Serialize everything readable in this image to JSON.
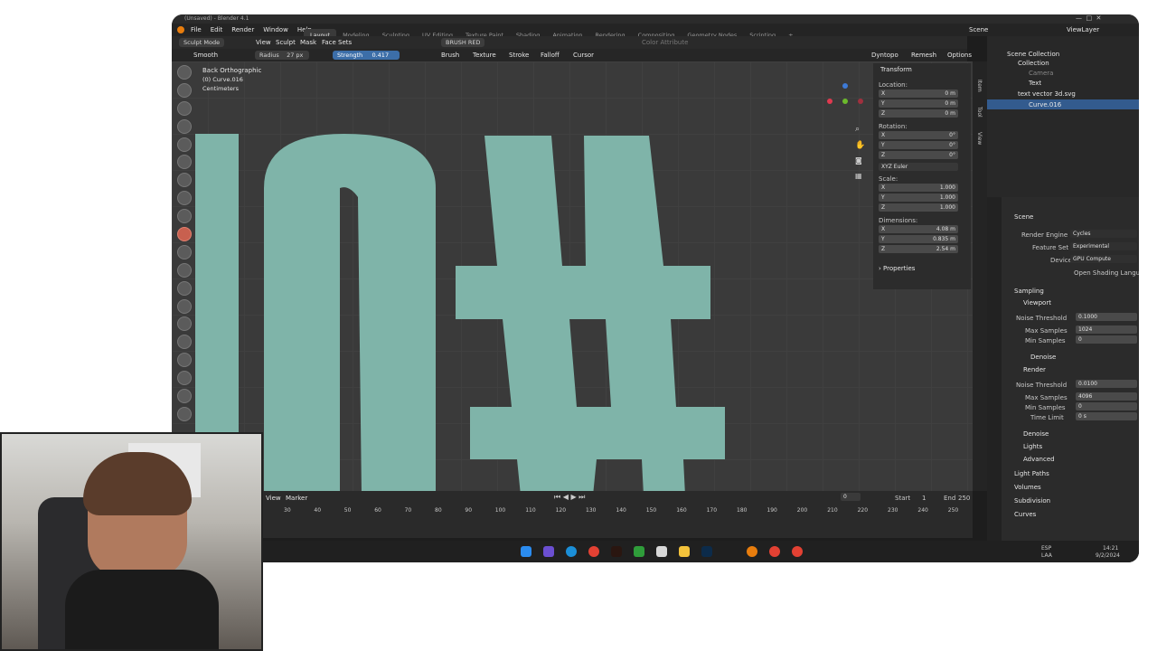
{
  "window": {
    "title": "(Unsaved) - Blender 4.1"
  },
  "menu": [
    "File",
    "Edit",
    "Render",
    "Window",
    "Help"
  ],
  "workspaces": [
    "Layout",
    "Modeling",
    "Sculpting",
    "UV Editing",
    "Texture Paint",
    "Shading",
    "Animation",
    "Rendering",
    "Compositing",
    "Geometry Nodes",
    "Scripting"
  ],
  "active_workspace": "Layout",
  "scene_name": "Scene",
  "view_layer": "ViewLayer",
  "tool_header": {
    "mode": "Sculpt Mode",
    "items": [
      "View",
      "Sculpt",
      "Mask",
      "Face Sets"
    ],
    "attribute": "Color Attribute",
    "color_attr": "BRUSH RED"
  },
  "brush_header": {
    "brush_name": "Smooth",
    "radius_label": "Radius",
    "radius_value": "27 px",
    "strength_label": "Strength",
    "strength_value": "0.417",
    "menus": [
      "Brush",
      "Texture",
      "Stroke",
      "Falloff",
      "Cursor"
    ],
    "right": [
      "Dyntopo",
      "Remesh",
      "Options"
    ]
  },
  "viewport": {
    "view_name": "Back Orthographic",
    "object": "(0) Curve.016",
    "units": "Centimeters",
    "shapes_color": "#7fb4a9"
  },
  "transform": {
    "title": "Transform",
    "location_label": "Location:",
    "location": [
      {
        "axis": "X",
        "value": "0 m"
      },
      {
        "axis": "Y",
        "value": "0 m"
      },
      {
        "axis": "Z",
        "value": "0 m"
      }
    ],
    "rotation_label": "Rotation:",
    "rotation": [
      {
        "axis": "X",
        "value": "0°"
      },
      {
        "axis": "Y",
        "value": "0°"
      },
      {
        "axis": "Z",
        "value": "0°"
      }
    ],
    "rotation_mode": "XYZ Euler",
    "scale_label": "Scale:",
    "scale": [
      {
        "axis": "X",
        "value": "1.000"
      },
      {
        "axis": "Y",
        "value": "1.000"
      },
      {
        "axis": "Z",
        "value": "1.000"
      }
    ],
    "dimensions_label": "Dimensions:",
    "dimensions": [
      {
        "axis": "X",
        "value": "4.08 m"
      },
      {
        "axis": "Y",
        "value": "0.835 m"
      },
      {
        "axis": "Z",
        "value": "2.54 m"
      }
    ],
    "properties": "Properties"
  },
  "outliner": {
    "root": "Scene Collection",
    "items": [
      "Collection",
      "Camera",
      "Text",
      "text vector 3d.svg",
      "Curve.016"
    ]
  },
  "render": {
    "scene": "Scene",
    "engine_label": "Render Engine",
    "engine": "Cycles",
    "feature_label": "Feature Set",
    "feature": "Experimental",
    "device_label": "Device",
    "device": "GPU Compute",
    "osl": "Open Shading Language",
    "sampling": "Sampling",
    "viewport": "Viewport",
    "vp_noise_label": "Noise Threshold",
    "vp_noise": "0.1000",
    "vp_max_label": "Max Samples",
    "vp_max": "1024",
    "vp_min_label": "Min Samples",
    "vp_min": "0",
    "denoise": "Denoise",
    "render": "Render",
    "r_noise_label": "Noise Threshold",
    "r_noise": "0.0100",
    "r_max_label": "Max Samples",
    "r_max": "4096",
    "r_min_label": "Min Samples",
    "r_min": "0",
    "time_label": "Time Limit",
    "time": "0 s",
    "denoise2": "Denoise",
    "lights": "Lights",
    "advanced": "Advanced",
    "light_paths": "Light Paths",
    "volumes": "Volumes",
    "subdivision": "Subdivision",
    "curves": "Curves"
  },
  "timeline": {
    "view": "View",
    "marker": "Marker",
    "current": "0",
    "start_label": "Start",
    "start": "1",
    "end_label": "End",
    "end": "250",
    "ticks": [
      "30",
      "40",
      "50",
      "60",
      "70",
      "80",
      "90",
      "100",
      "110",
      "120",
      "130",
      "140",
      "150",
      "160",
      "170",
      "180",
      "190",
      "200",
      "210",
      "220",
      "230",
      "240",
      "250"
    ]
  },
  "taskbar": {
    "lang1": "ESP",
    "lang2": "LAA",
    "time": "14:21",
    "date": "9/2/2024"
  }
}
